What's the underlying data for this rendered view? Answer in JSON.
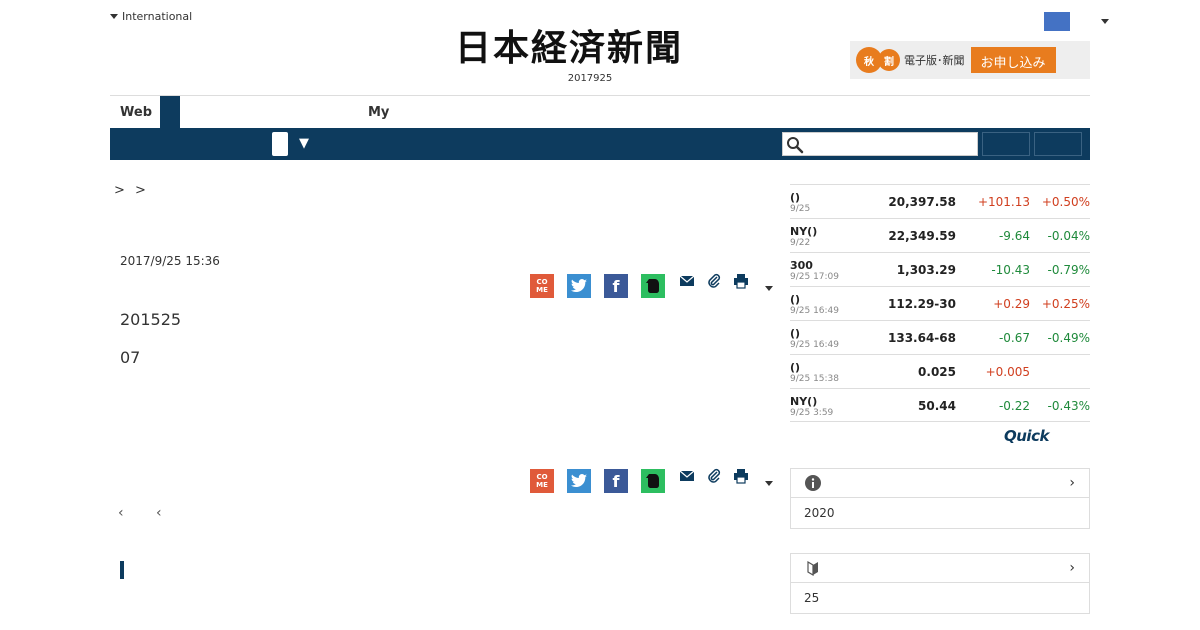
{
  "header": {
    "international_label": "International",
    "logo_text": "日本経済新聞",
    "date": "2017925",
    "promo": {
      "badge1": "秋",
      "badge2": "割",
      "text": "電子版･新聞",
      "button": "お申し込み"
    }
  },
  "tabs": {
    "web": "Web",
    "my": "My"
  },
  "nav": {
    "dropdown_arrow": "▼",
    "search_placeholder": ""
  },
  "breadcrumb": "> >",
  "article": {
    "date": "2017/9/25 15:36",
    "paragraph1": "201525",
    "paragraph2": "07",
    "pager": "‹ ‹"
  },
  "share": {
    "come_label": "CO ME",
    "twitter_label": "t",
    "facebook_label": "f",
    "evernote_label": "e"
  },
  "market": {
    "rows": [
      {
        "name": "()",
        "time": "9/25",
        "value": "20,397.58",
        "change": "+101.13",
        "pct": "+0.50%",
        "dir": "up"
      },
      {
        "name": "NY()",
        "time": "9/22",
        "value": "22,349.59",
        "change": "-9.64",
        "pct": "-0.04%",
        "dir": "down"
      },
      {
        "name": "300",
        "time": "9/25 17:09",
        "value": "1,303.29",
        "change": "-10.43",
        "pct": "-0.79%",
        "dir": "down"
      },
      {
        "name": "()",
        "time": "9/25 16:49",
        "value": "112.29-30",
        "change": "+0.29",
        "pct": "+0.25%",
        "dir": "up"
      },
      {
        "name": "()",
        "time": "9/25 16:49",
        "value": "133.64-68",
        "change": "-0.67",
        "pct": "-0.49%",
        "dir": "down"
      },
      {
        "name": "()",
        "time": "9/25 15:38",
        "value": "0.025",
        "change": "+0.005",
        "pct": "",
        "dir": "up"
      },
      {
        "name": "NY()",
        "time": "9/25 3:59",
        "value": "50.44",
        "change": "-0.22",
        "pct": "-0.43%",
        "dir": "down"
      }
    ],
    "source": "Quick"
  },
  "side_boxes": {
    "box1_body": "2020",
    "box2_body": "25"
  },
  "colors": {
    "navy": "#0d3b5e",
    "orange": "#e87c1e",
    "up": "#d03e1e",
    "down": "#1f8a3b"
  }
}
